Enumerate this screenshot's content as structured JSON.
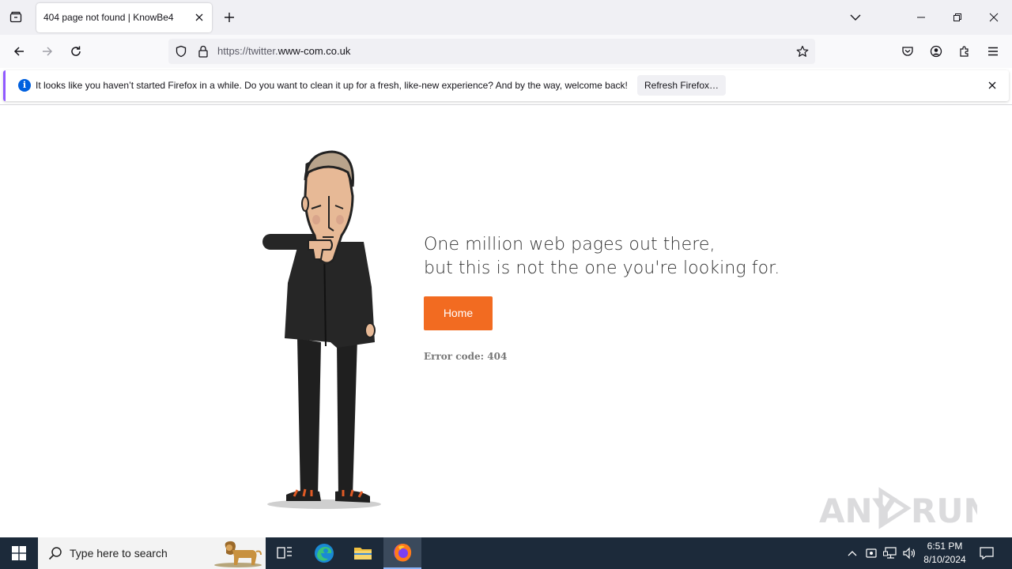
{
  "browser": {
    "tab": {
      "title": "404 page not found | KnowBe4"
    },
    "url": {
      "prefix": "https://twitter.",
      "domain": "www-com.co.uk"
    }
  },
  "notification": {
    "message": "It looks like you haven’t started Firefox in a while. Do you want to clean it up for a fresh, like-new experience? And by the way, welcome back!",
    "button_label": "Refresh Firefox…"
  },
  "page": {
    "headline_line1": "One million web pages out there,",
    "headline_line2": "but this is not the one you're looking for.",
    "home_button": "Home",
    "error_code": "Error code: 404",
    "accent_color": "#f26b21"
  },
  "watermark": {
    "text_left": "ANY",
    "text_right": "RUN"
  },
  "taskbar": {
    "search_placeholder": "Type here to search",
    "time": "6:51 PM",
    "date": "8/10/2024"
  }
}
